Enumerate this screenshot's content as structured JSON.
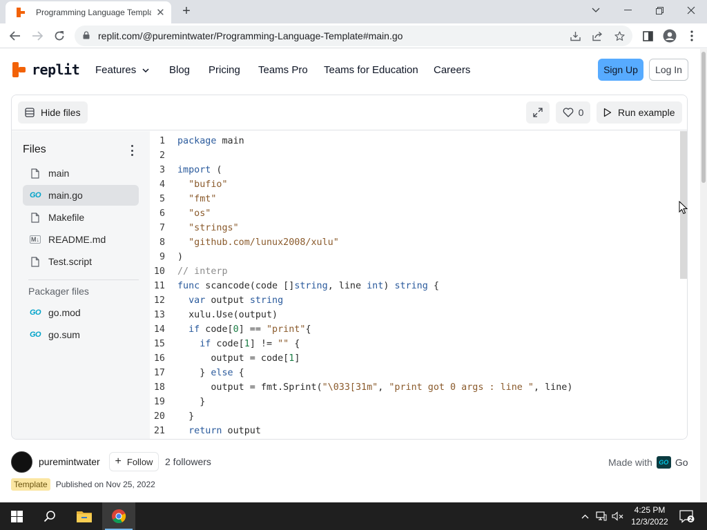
{
  "browser": {
    "tab_title": "Programming Language Template",
    "url": "replit.com/@puremintwater/Programming-Language-Template#main.go",
    "icons": [
      "replit-favicon",
      "close-icon",
      "plus-icon",
      "chevron-down-icon",
      "minimize-icon",
      "restore-icon",
      "close-window-icon",
      "back-arrow-icon",
      "forward-arrow-icon",
      "reload-icon",
      "lock-icon",
      "install-icon",
      "share-icon",
      "star-icon",
      "side-panel-icon",
      "profile-icon",
      "more-vert-icon"
    ]
  },
  "site": {
    "logo_text": "replit",
    "nav": [
      "Features",
      "Blog",
      "Pricing",
      "Teams Pro",
      "Teams for Education",
      "Careers"
    ],
    "signup": "Sign Up",
    "login": "Log In",
    "accent": "#f26207",
    "signup_color": "#57abff"
  },
  "repl": {
    "hide_files": "Hide files",
    "likes": "0",
    "run_example": "Run example",
    "files_title": "Files",
    "files": [
      {
        "name": "main",
        "icon": "file-icon"
      },
      {
        "name": "main.go",
        "icon": "go-icon",
        "active": true
      },
      {
        "name": "Makefile",
        "icon": "file-icon"
      },
      {
        "name": "README.md",
        "icon": "markdown-icon"
      },
      {
        "name": "Test.script",
        "icon": "file-icon"
      }
    ],
    "packager_title": "Packager files",
    "packager_files": [
      {
        "name": "go.mod",
        "icon": "go-icon"
      },
      {
        "name": "go.sum",
        "icon": "go-icon"
      }
    ],
    "code_lines": [
      "package main",
      "",
      "import (",
      "  \"bufio\"",
      "  \"fmt\"",
      "  \"os\"",
      "  \"strings\"",
      "  \"github.com/lunux2008/xulu\"",
      ")",
      "// interp",
      "func scancode(code []string, line int) string {",
      "  var output string",
      "  xulu.Use(output)",
      "  if code[0] == \"print\"{",
      "    if code[1] != \"\" {",
      "      output = code[1]",
      "    } else {",
      "      output = fmt.Sprint(\"\\033[31m\", \"print got 0 args : line \", line)",
      "    }",
      "  }",
      "  return output"
    ]
  },
  "author": {
    "name": "puremintwater",
    "follow": "Follow",
    "followers": "2 followers",
    "made_with": "Made with",
    "language": "Go",
    "badge": "Template",
    "published": "Published on Nov 25, 2022"
  },
  "taskbar": {
    "time": "4:25 PM",
    "date": "12/3/2022",
    "notifications": "2"
  }
}
